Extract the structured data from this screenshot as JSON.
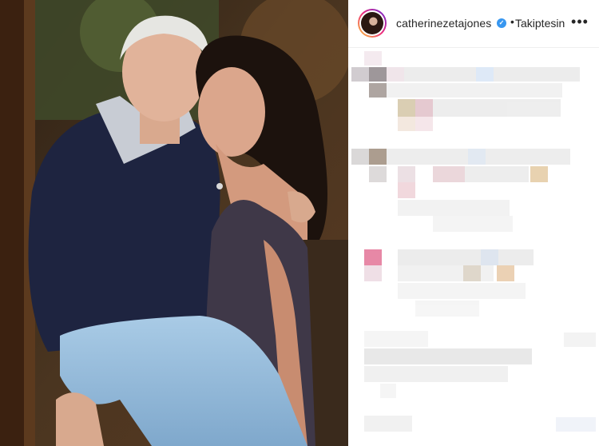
{
  "post": {
    "username": "catherinezetajones",
    "follow_label": "Takiptesin",
    "separator": "•",
    "verified_mark": "✓",
    "more_icon": "•••"
  },
  "colors": {
    "accent": "#3897f0",
    "text": "#262626",
    "border": "#dbdbdb"
  }
}
